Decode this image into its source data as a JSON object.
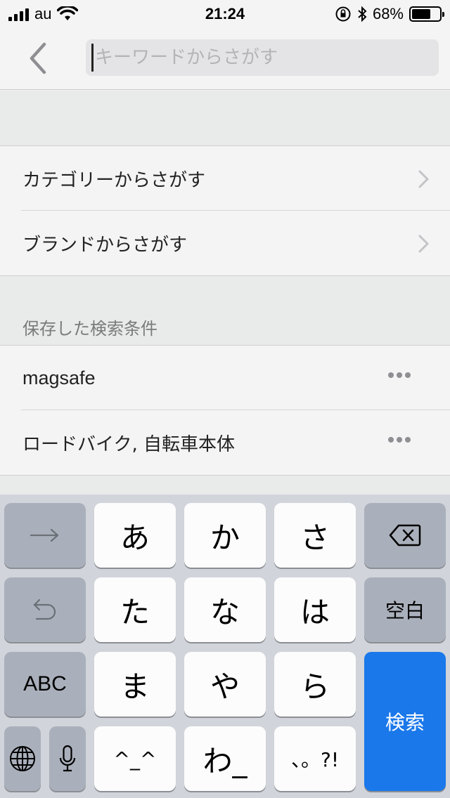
{
  "status_bar": {
    "carrier": "au",
    "time": "21:24",
    "battery_percent": "68%",
    "battery_level": 0.68,
    "icons": [
      "signal-icon",
      "wifi-icon",
      "orientation-lock-icon",
      "bluetooth-icon",
      "battery-icon"
    ]
  },
  "search": {
    "placeholder": "キーワードからさがす",
    "value": ""
  },
  "nav_items": [
    {
      "label": "カテゴリーからさがす"
    },
    {
      "label": "ブランドからさがす"
    }
  ],
  "saved_section": {
    "header": "保存した検索条件",
    "items": [
      {
        "label": "magsafe"
      },
      {
        "label": "ロードバイク, 自転車本体"
      }
    ]
  },
  "keyboard": {
    "row1": [
      "あ",
      "か",
      "さ"
    ],
    "row2": [
      "た",
      "な",
      "は"
    ],
    "row3": [
      "ま",
      "や",
      "ら"
    ],
    "row4": [
      "^_^",
      "わ_",
      "、。?!"
    ],
    "space_label": "空白",
    "abc_label": "ABC",
    "search_label": "検索",
    "icons": [
      "arrow-right-icon",
      "undo-icon",
      "globe-icon",
      "microphone-icon",
      "delete-icon"
    ]
  },
  "colors": {
    "accent_blue": "#1a78ea",
    "background": "#f3f4f3",
    "keyboard_bg": "#d1d4da"
  }
}
